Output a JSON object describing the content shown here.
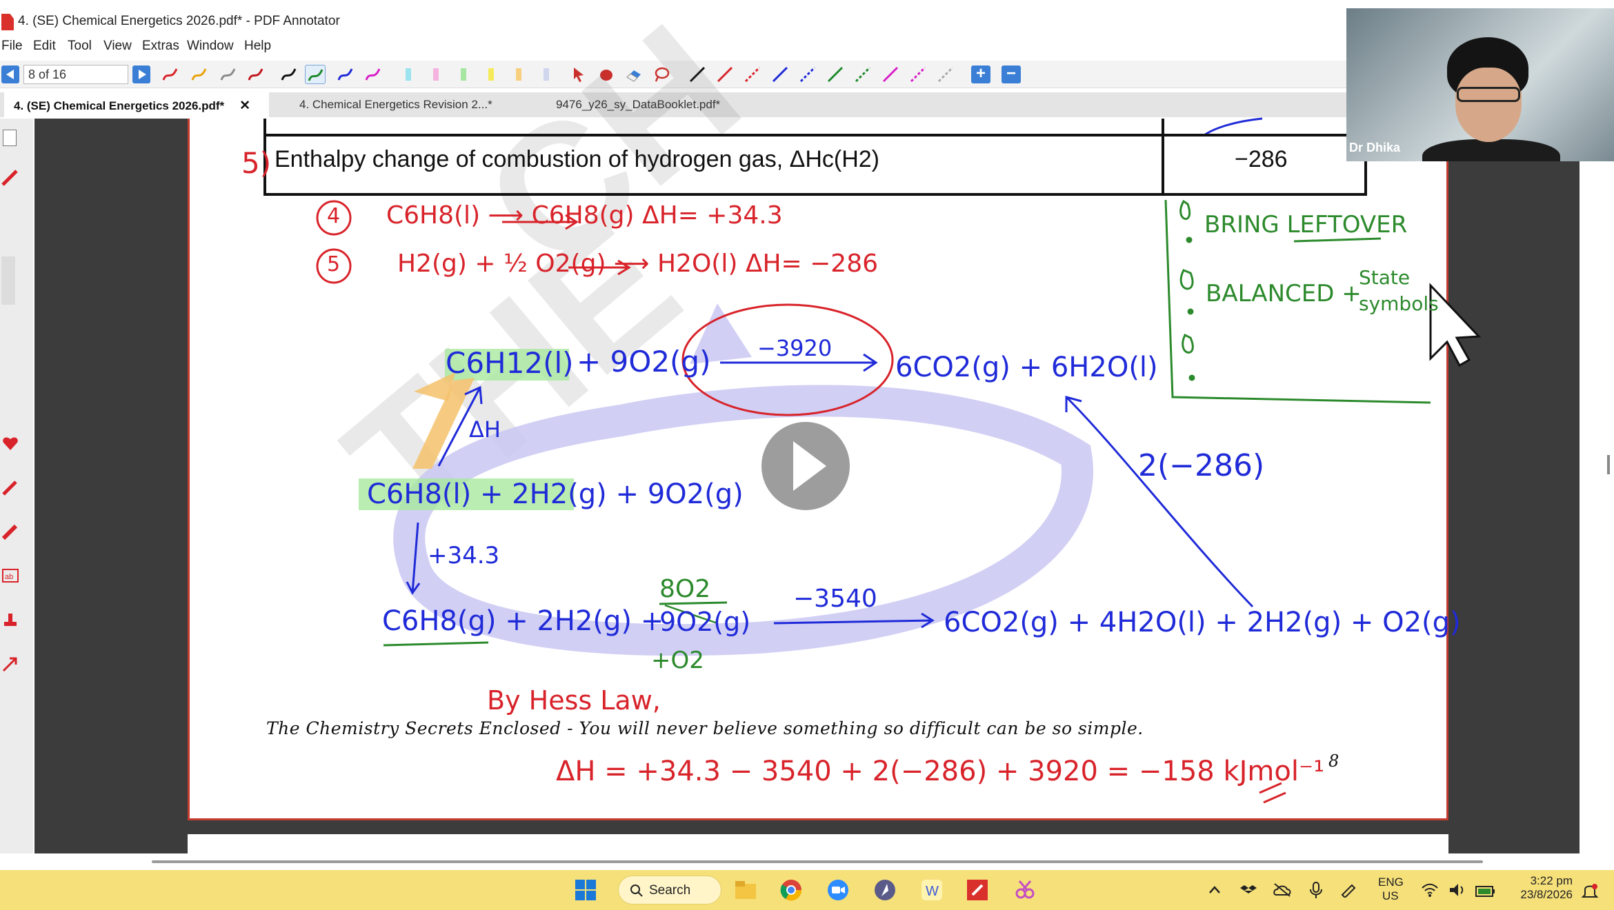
{
  "window": {
    "title": "4. (SE) Chemical Energetics 2026.pdf* - PDF Annotator"
  },
  "menu": [
    "File",
    "Edit",
    "Tool",
    "View",
    "Extras",
    "Window",
    "Help"
  ],
  "toolbar": {
    "page_indicator": "8 of 16"
  },
  "tabs": [
    {
      "label": "4. (SE) Chemical Energetics 2026.pdf*",
      "close": "✕",
      "active": true
    },
    {
      "label": "4. Chemical Energetics Revision 2...*",
      "active": false
    },
    {
      "label": "9476_y26_sy_DataBooklet.pdf*",
      "active": false
    }
  ],
  "document": {
    "table_row": {
      "number": "5)",
      "label": "Enthalpy change of combustion of hydrogen gas, ΔHc(H2)",
      "value": "−286"
    },
    "handwriting": {
      "eq4_num": "4",
      "eq4": "C6H8(l) ⟶ C6H8(g)   ΔH= +34.3",
      "eq5_num": "5",
      "eq5": "H2(g) + ½ O2(g) ⟶ H2O(l)   ΔH= −286",
      "top_left": "C6H12(l)",
      "top_mid": "+ 9O2(g)",
      "top_arrow_value": "−3920",
      "top_right": "6CO2(g) + 6H2O(l)",
      "delta_h": "ΔH",
      "middle_left": "C6H8(l) + 2H2(g) + 9O2(g)",
      "plus343": "+34.3",
      "right_value": "2(−286)",
      "bottom_left": "C6H8(g) + 2H2(g) +",
      "frac_top": "8O2",
      "frac_bottom": "9O2(g)",
      "plus_o2": "+O2",
      "bottom_arrow_value": "−3540",
      "bottom_right": "6CO2(g) + 4H2O(l) + 2H2(g) + O2(g)",
      "by_hess": "By Hess Law,",
      "final": "ΔH = +34.3 − 3540 + 2(−286) + 3920  =  −158 kJmol⁻¹",
      "tips": [
        "BRING LEFTOVER",
        "BALANCED +",
        "State",
        "symbols"
      ]
    },
    "footer": "The Chemistry Secrets Enclosed - You will never believe something so difficult can be so simple.",
    "page_number": "8"
  },
  "webcam": {
    "name": "Dr Dhika"
  },
  "taskbar": {
    "search_label": "Search",
    "lang_top": "ENG",
    "lang_bottom": "US",
    "time": "3:22 pm",
    "date": "23/8/2026"
  },
  "colors": {
    "annotation_red": "#d8232a",
    "annotation_blue": "#1f2ad8",
    "annotation_green": "#2c8a2c",
    "taskbar": "#f6e07a",
    "page_border": "#c53b2f"
  }
}
